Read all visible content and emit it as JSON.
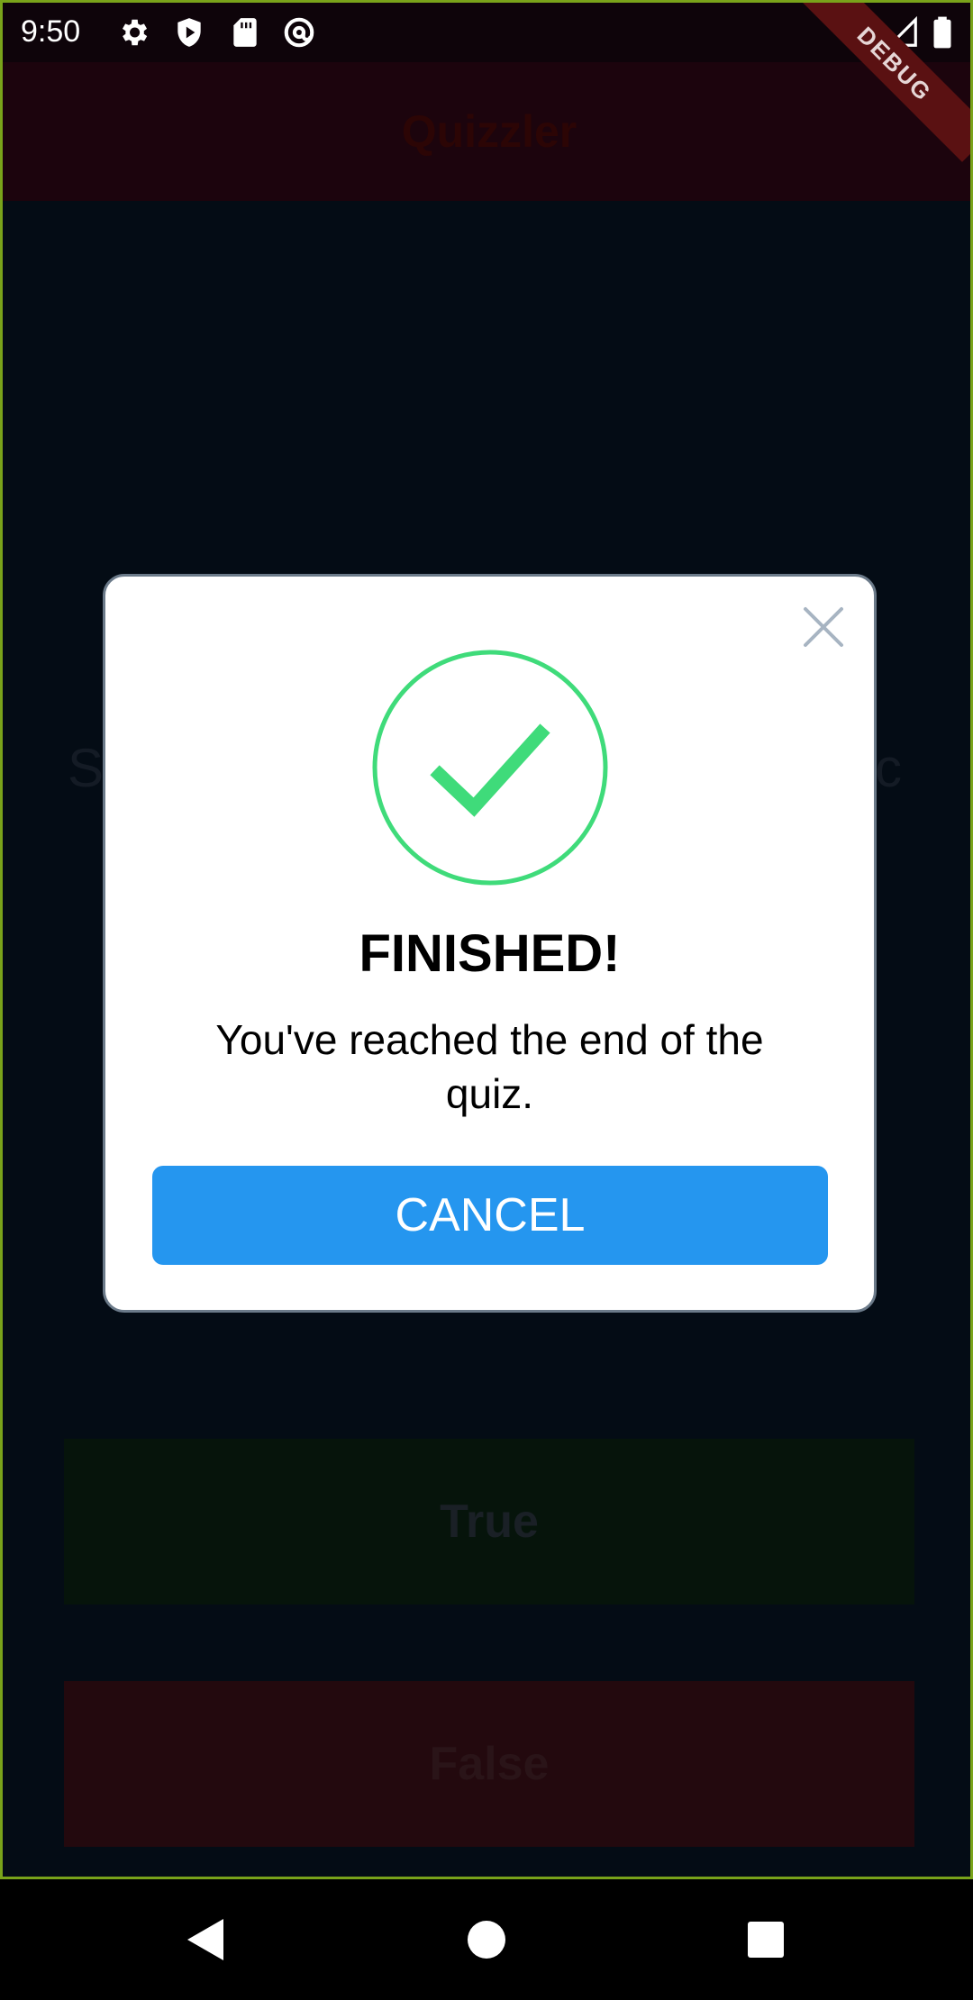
{
  "status_bar": {
    "time": "9:50",
    "icons": [
      "gear-icon",
      "play-protect-icon",
      "sd-card-icon",
      "at-sign-icon",
      "wifi-icon",
      "cellular-signal-icon",
      "battery-icon"
    ]
  },
  "debug_banner": "DEBUG",
  "app_bar": {
    "title": "Quizzler",
    "background": "#1c040d"
  },
  "quiz": {
    "question_fragment_left": "S",
    "question_fragment_right": "c",
    "answers": {
      "true_label": "True",
      "false_label": "False"
    }
  },
  "dialog": {
    "icon": "success-check-icon",
    "title": "FINISHED!",
    "message": "You've reached the end of the quiz.",
    "cancel_label": "CANCEL",
    "close_icon": "close-icon",
    "accent_color": "#3fdb7a",
    "button_color": "#2596ef"
  },
  "nav_bar": {
    "icons": [
      "back-icon",
      "home-icon",
      "recents-icon"
    ]
  }
}
